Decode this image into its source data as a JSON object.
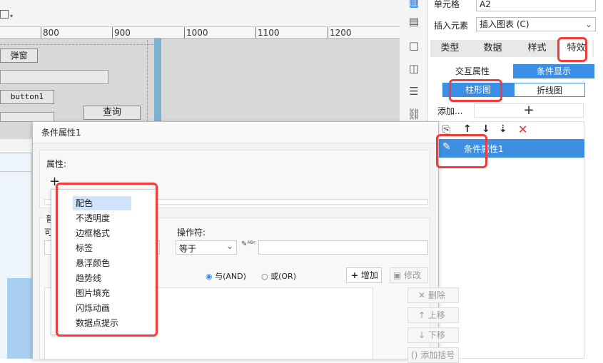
{
  "ruler": {
    "ticks": [
      "800",
      "900",
      "1000",
      "1100",
      "1200"
    ]
  },
  "canvas_widgets": {
    "popup_btn": "弹窗",
    "button1": "button1",
    "query_btn": "查询"
  },
  "panel": {
    "cell_label": "单元格",
    "cell_value": "A2",
    "insert_label": "插入元素",
    "insert_value": "插入图表 (C)",
    "tabs": [
      "类型",
      "数据",
      "样式",
      "特效"
    ],
    "sub_tabs": [
      "交互属性",
      "条件显示"
    ],
    "chart_tabs": [
      "柱形图",
      "折线图"
    ],
    "add_label": "添加...",
    "add_symbol": "+",
    "condition_item": "条件属性1"
  },
  "dialog": {
    "title": "条件属性1",
    "attr_label": "属性:",
    "add_symbol": "+",
    "general_label": "普",
    "op_label": "操作符:",
    "op_value": "等于",
    "left_value_prefix": "可",
    "and_label": "与(AND)",
    "or_label": "或(OR)",
    "add_button": "增加",
    "modify_button": "修改",
    "delete_button": "删除",
    "up_button": "上移",
    "down_button": "下移",
    "bracket_button": "添加括号"
  },
  "menu": {
    "items": [
      "配色",
      "不透明度",
      "边框格式",
      "标签",
      "悬浮颜色",
      "趋势线",
      "图片填充",
      "闪烁动画",
      "数据点提示"
    ]
  },
  "colors": {
    "accent": "#3a8ee6",
    "highlight": "#f03c3c",
    "selection": "#3d8fe2"
  }
}
